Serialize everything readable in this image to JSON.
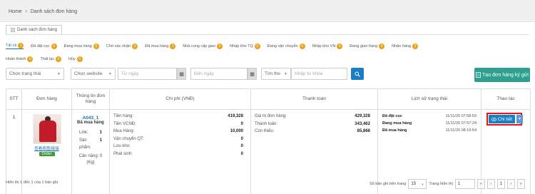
{
  "breadcrumb": {
    "home": "Home",
    "separator": ">",
    "current": "Danh sách đơn hàng"
  },
  "tab": {
    "label": "Danh sách đơn hàng"
  },
  "filters": {
    "row1": [
      {
        "label": "Tất cả",
        "count": "1",
        "active": true
      },
      {
        "label": "Đã đặt cọc",
        "count": "0"
      },
      {
        "label": "Đang mua hàng",
        "count": "0"
      },
      {
        "label": "Chờ xác nhận",
        "count": "0"
      },
      {
        "label": "Đã mua hàng",
        "count": "1"
      },
      {
        "label": "Nhà cung cấp giao",
        "count": "0"
      },
      {
        "label": "Nhập kho TQ",
        "count": "0"
      },
      {
        "label": "Đang vận chuyển",
        "count": "0"
      },
      {
        "label": "Nhập kho VN",
        "count": "0"
      },
      {
        "label": "Đang giao hàng",
        "count": "0"
      },
      {
        "label": "Nhận hàng",
        "count": "0"
      }
    ],
    "row2": [
      {
        "label": "Hoàn thành",
        "count": "0"
      },
      {
        "label": "Thất lạc",
        "count": "0"
      },
      {
        "label": "Hủy",
        "count": "0"
      }
    ]
  },
  "search": {
    "status_select": "Chọn trạng thái",
    "website_select": "Chọn website",
    "from_date": "Từ ngày",
    "to_date": "Đến ngày",
    "field_select": "Tìm the",
    "keyword_placeholder": "Nhập từ khóa"
  },
  "create_button": "Tạo đơn hàng ký gửi",
  "table": {
    "headers": {
      "stt": "STT",
      "order": "Đơn hàng",
      "info": "Thông tin đơn hàng",
      "cost": "Chi phí (VNĐ)",
      "payment": "Thanh toán",
      "history": "Lịch sử trạng thái",
      "actions": "Thao tác"
    },
    "row": {
      "stt": "1",
      "product_link": "查看原图/链接",
      "order_tag": "Order",
      "code": "A043_1",
      "status": "Đã mua hàng",
      "links_label": "Link:",
      "links_value": "1",
      "products_label": "Sản phẩm:",
      "products_value": "1",
      "weight": "Cân nặng: 0 (Kg)",
      "costs": [
        {
          "label": "Tiền hàng:",
          "value": "419,328"
        },
        {
          "label": "Tiền VCNĐ:",
          "value": "0"
        },
        {
          "label": "Mua Hàng:",
          "value": "10,000"
        },
        {
          "label": "Vận chuyển QT:",
          "value": "0"
        },
        {
          "label": "Lưu kho:",
          "value": "0"
        },
        {
          "label": "Phát sinh:",
          "value": "0"
        }
      ],
      "payments": [
        {
          "label": "Giá trị đơn hàng:",
          "value": "429,328"
        },
        {
          "label": "Thanh toán:",
          "value": "343,462"
        },
        {
          "label": "Còn thiếu:",
          "value": "85,866"
        }
      ],
      "history": [
        {
          "status": "Đã đặt cọc",
          "time": "11/11/20 07:58:59"
        },
        {
          "status": "Đang mua hàng",
          "time": "11/11/20 07:57:24"
        },
        {
          "status": "Đã mua hàng",
          "time": "11/11/20 08:19:54"
        }
      ],
      "detail_button": "Chi tiết"
    }
  },
  "footer": {
    "summary": "Hiển thị 1 đến 1 của 1 bản ghi",
    "per_page_label": "Số bản ghi trên trang",
    "per_page": "15",
    "page_label": "Trang hiển thị",
    "page_value": "1",
    "current_page": "1"
  }
}
